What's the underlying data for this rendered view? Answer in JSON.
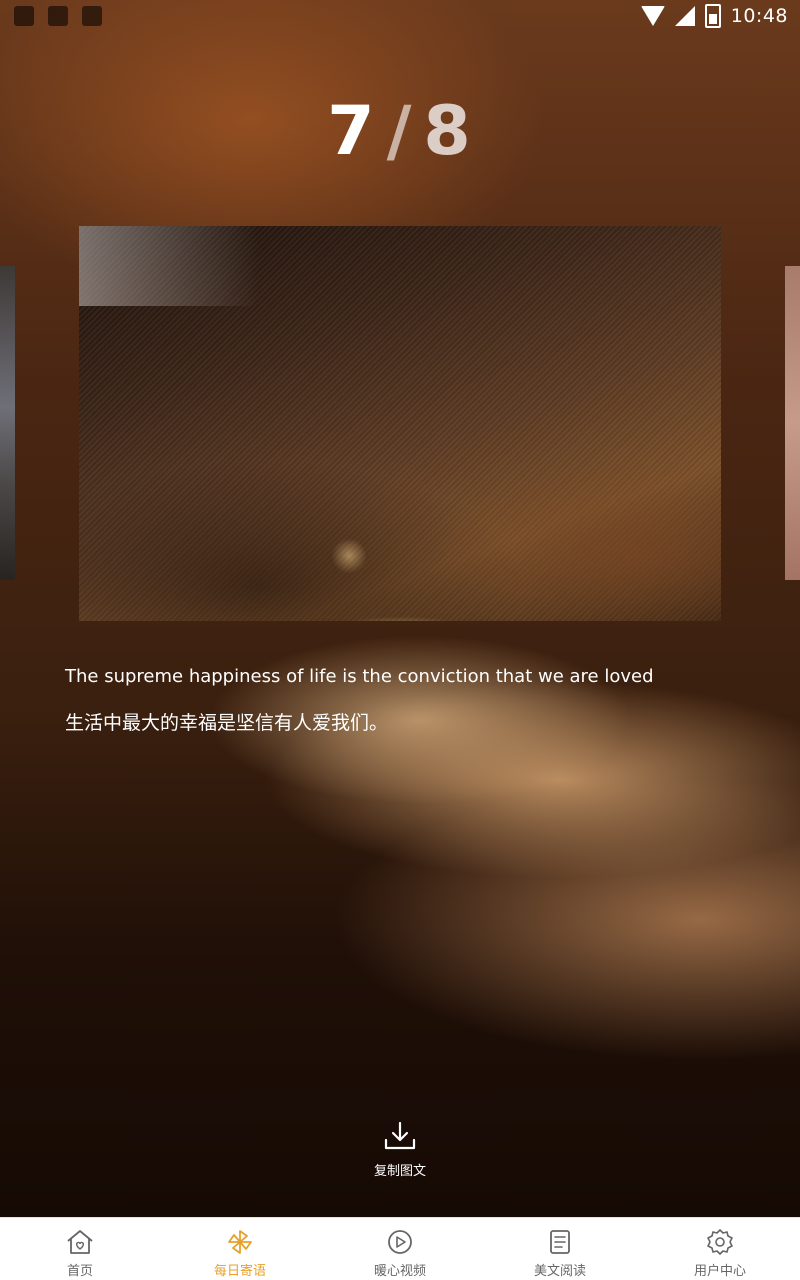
{
  "status_bar": {
    "time": "10:48",
    "icons": [
      "notification-icon",
      "notification-icon",
      "notification-icon",
      "wifi-icon",
      "signal-icon",
      "battery-icon"
    ]
  },
  "pager": {
    "current": "7",
    "separator": "/",
    "total": "8"
  },
  "quote": {
    "english": "The supreme happiness of life is the conviction that we are loved",
    "chinese": "生活中最大的幸福是坚信有人爱我们。"
  },
  "actions": {
    "copy_label": "复制图文",
    "copy_icon": "download-icon"
  },
  "bottom_nav": {
    "active_color": "#e7a02a",
    "items": [
      {
        "label": "首页",
        "icon": "home-icon"
      },
      {
        "label": "每日寄语",
        "icon": "pinwheel-icon"
      },
      {
        "label": "暖心视频",
        "icon": "play-icon"
      },
      {
        "label": "美文阅读",
        "icon": "article-icon"
      },
      {
        "label": "用户中心",
        "icon": "gear-icon"
      }
    ]
  }
}
